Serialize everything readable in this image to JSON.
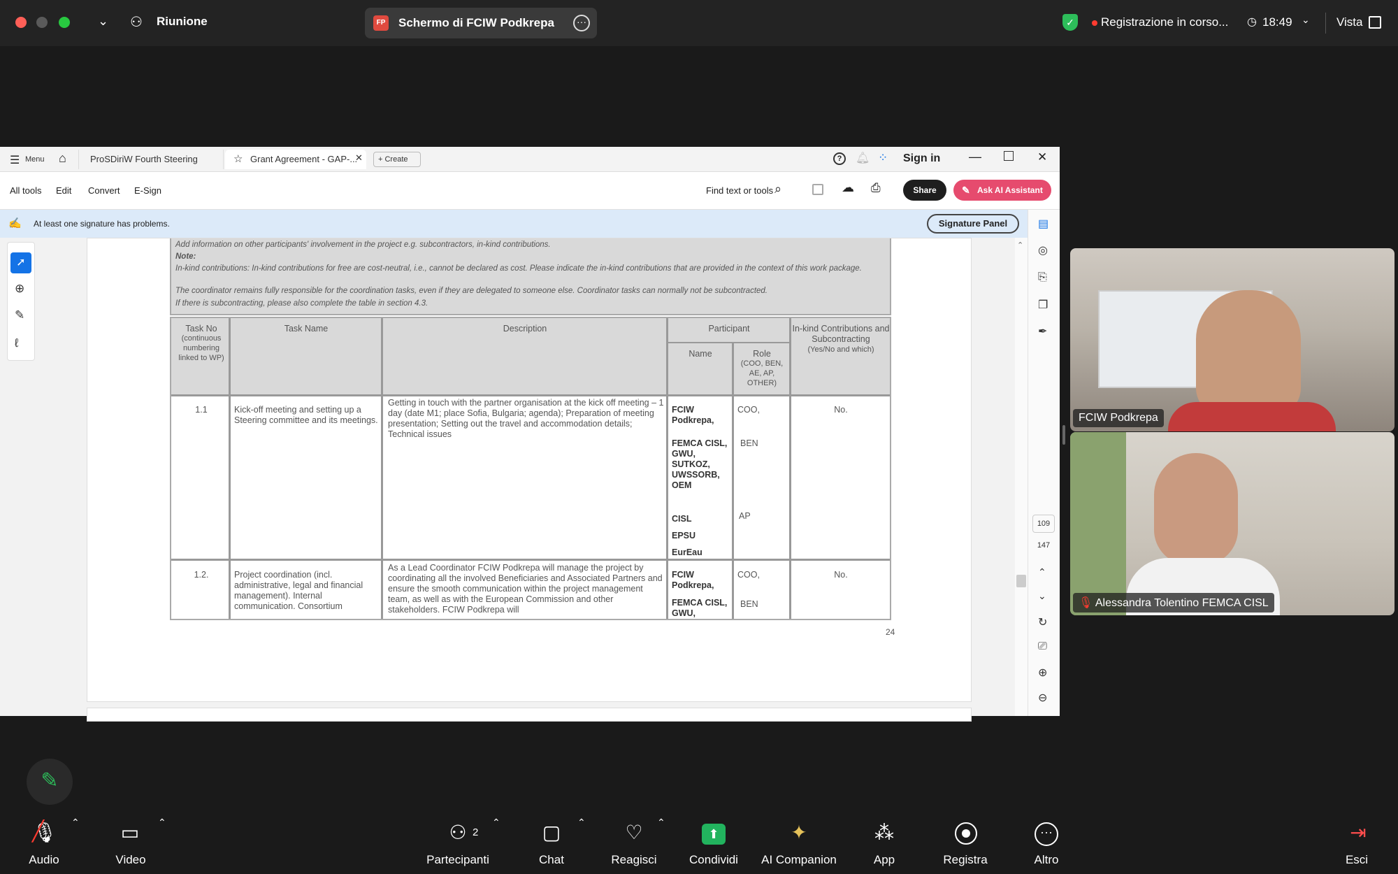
{
  "meeting": {
    "title": "Riunione",
    "screen_title": "Schermo di FCIW Podkrepa",
    "screen_badge": "FP",
    "recording": "Registrazione in corso...",
    "time": "18:49",
    "view": "Vista"
  },
  "doc": {
    "tabs": [
      "Menu",
      "ProSDiriW Fourth Steering Com...",
      "Grant Agreement - GAP-...",
      "Create"
    ],
    "sign_in": "Sign in",
    "menu": [
      "All tools",
      "Edit",
      "Convert",
      "E-Sign"
    ],
    "find": "Find text or tools",
    "share": "Share",
    "ask_ai": "Ask AI Assistant",
    "sig_warning": "At least one signature has problems.",
    "sig_panel": "Signature Panel",
    "page_current": "109",
    "page_total": "147",
    "page_number": "24",
    "intro": [
      "Add information on other participants' involvement in the project e.g. subcontractors, in-kind contributions.",
      "Note:",
      "In-kind contributions: In-kind contributions for free are cost-neutral, i.e., cannot be declared as cost. Please indicate the in-kind contributions that are provided in the context of this work package.",
      "The coordinator remains fully responsible for the coordination tasks, even if they are delegated to someone else. Coordinator tasks can normally not be subcontracted.",
      "If there is subcontracting, please also complete the table in section 4.3."
    ],
    "table": {
      "h_taskno": "Task No",
      "h_taskno_sub": "(continuous numbering linked to WP)",
      "h_taskname": "Task Name",
      "h_desc": "Description",
      "h_participant": "Participant",
      "h_name": "Name",
      "h_role": "Role",
      "h_role_sub": "(COO, BEN, AE, AP, OTHER)",
      "h_inkind": "In-kind Contributions and Subcontracting",
      "h_inkind_sub": "(Yes/No and which)",
      "rows": [
        {
          "no": "1.1",
          "name": "Kick-off meeting and setting up a Steering committee and its meetings.",
          "desc": "Getting in touch with the partner organisation at the kick off meeting – 1 day (date M1; place Sofia, Bulgaria; agenda); Preparation of meeting presentation; Setting out the travel and accommodation details; Technical issues",
          "p1": "FCIW Podkrepa,",
          "p2": "FEMCA CISL, GWU, SUTKOZ, UWSSORB, OEM",
          "p3": "CISL",
          "p4": "EPSU",
          "p5": "EurEau",
          "r1": "COO,",
          "r2": "BEN",
          "r3": "AP",
          "inkind": "No."
        },
        {
          "no": "1.2.",
          "name": "Project coordination (incl. administrative, legal and financial management). Internal communication. Consortium",
          "desc": "As a Lead Coordinator FCIW Podkrepa will manage the project by coordinating all the involved Beneficiaries and Associated Partners and ensure the smooth communication within the project management team, as well as with the European Commission and other stakeholders. FCIW Podkrepa will",
          "p1": "FCIW Podkrepa,",
          "p2": "FEMCA CISL, GWU,",
          "r1": "COO,",
          "r2": "BEN",
          "inkind": "No."
        }
      ]
    }
  },
  "participants": [
    {
      "name": "FCIW Podkrepa"
    },
    {
      "name": "Alessandra Tolentino FEMCA CISL"
    }
  ],
  "bottombar": {
    "audio": "Audio",
    "video": "Video",
    "participants": "Partecipanti",
    "participants_count": "2",
    "chat": "Chat",
    "react": "Reagisci",
    "share": "Condividi",
    "ai": "AI Companion",
    "app": "App",
    "record": "Registra",
    "more": "Altro",
    "leave": "Esci"
  },
  "colors": {
    "share_green": "#22b35e",
    "ai_button": "#e64b6e",
    "accent_blue": "#1473e6"
  }
}
